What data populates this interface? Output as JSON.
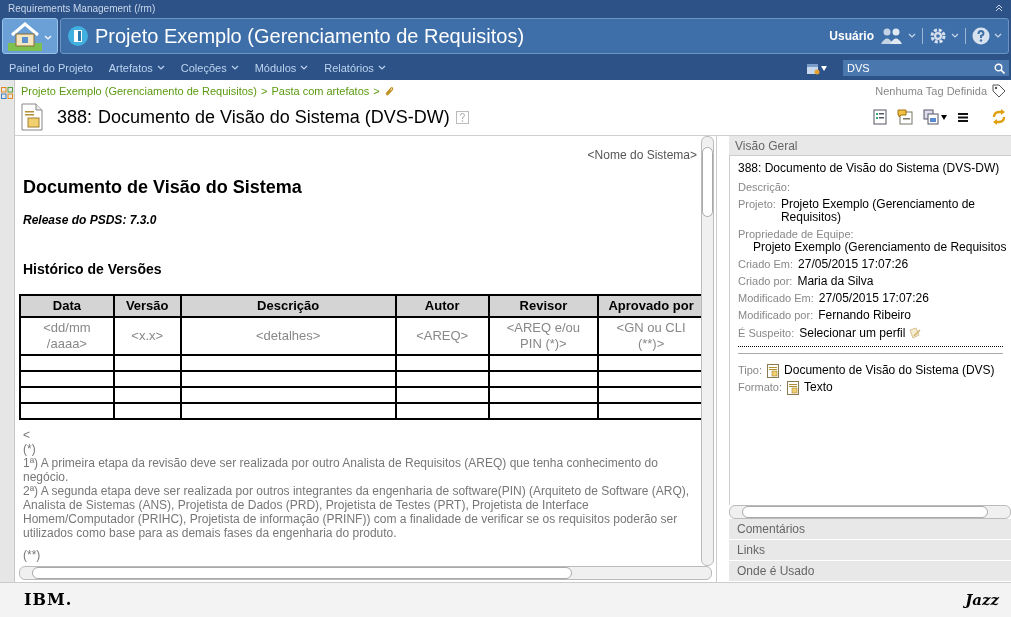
{
  "app_title": "Requirements Management (/rm)",
  "header": {
    "title": "Projeto Exemplo (Gerenciamento de Requisitos)",
    "user_label": "Usuário"
  },
  "nav": {
    "items": [
      "Painel do Projeto",
      "Artefatos",
      "Coleções",
      "Módulos",
      "Relatórios"
    ]
  },
  "search": {
    "value": "DVS"
  },
  "breadcrumb": {
    "items": [
      "Projeto Exemplo (Gerenciamento de Requisitos)",
      "Pasta com artefatos"
    ],
    "separator": ">"
  },
  "tag_label": "Nenhuma Tag Definida",
  "artifact": {
    "id": "388:",
    "title": "Documento de Visão do Sistema (DVS-DW)"
  },
  "document": {
    "system_name": "<Nome do Sistema>",
    "heading": "Documento de Visão do Sistema",
    "release": "Release do PSDS: 7.3.0",
    "history_heading": "Histórico de Versões",
    "table": {
      "columns": [
        "Data",
        "Versão",
        "Descrição",
        "Autor",
        "Revisor",
        "Aprovado por"
      ],
      "rows": [
        [
          "<dd/mm /aaaa>",
          "<x.x>",
          "<detalhes>",
          "<AREQ>",
          "<AREQ e/ou PIN (*)>",
          "<GN ou CLI (**)>"
        ]
      ]
    },
    "notes": [
      "<",
      "(*)",
      "1ª) A primeira etapa da revisão deve ser realizada por outro Analista de Requisitos (AREQ) que tenha conhecimento do negócio.",
      "2ª) A segunda etapa deve ser realizada por outros integrantes da engenharia de software(PIN) (Arquiteto de Software (ARQ), Analista de Sistemas (ANS), Projetista de Dados (PRD), Projetista de Testes (PRT), Projetista de Interface Homem/Computador (PRIHC), Projetista de informação (PRINF)) com a finalidade de verificar se os requisitos poderão ser utilizados como base para as demais fases da engenharia do produto."
    ],
    "notes_end": "(**)"
  },
  "sidebar": {
    "overview": {
      "title": "Visão Geral",
      "summary": "388: Documento de Visão do Sistema (DVS-DW)",
      "fields": [
        {
          "kind": "inline",
          "label": "Descrição:"
        },
        {
          "kind": "inline",
          "label": "Projeto:",
          "value": "Projeto Exemplo (Gerenciamento de Requisitos)"
        },
        {
          "kind": "block",
          "label": "Propriedade de Equipe:",
          "value": "Projeto Exemplo (Gerenciamento de Requisitos"
        },
        {
          "kind": "inline",
          "label": "Criado Em:",
          "value": "27/05/2015 17:07:26"
        },
        {
          "kind": "inline",
          "label": "Criado por:",
          "value": "Maria da Silva"
        },
        {
          "kind": "inline",
          "label": "Modificado Em:",
          "value": "27/05/2015 17:07:26"
        },
        {
          "kind": "inline",
          "label": "Modificado por:",
          "value": "Fernando Ribeiro"
        },
        {
          "kind": "profile",
          "label": "É Suspeito:",
          "value": "Selecionar um perfil"
        }
      ],
      "type_fields": [
        {
          "label": "Tipo:",
          "value": "Documento de Visão do Sistema (DVS)"
        },
        {
          "label": "Formato:",
          "value": "Texto"
        }
      ]
    },
    "sections": [
      "Comentários",
      "Links",
      "Onde é Usado"
    ]
  },
  "footer": {
    "left_logo": "IBM.",
    "right_logo": "Jazz"
  }
}
